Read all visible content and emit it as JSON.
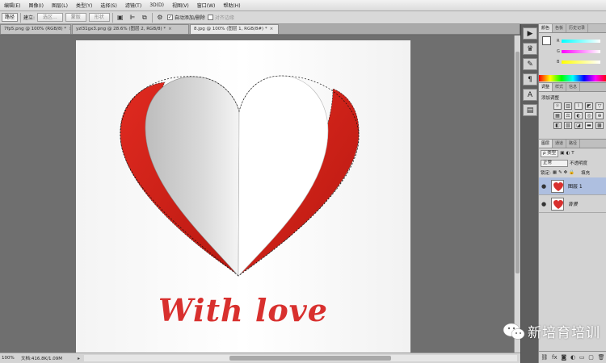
{
  "menu": [
    "编辑(E)",
    "图像(I)",
    "图层(L)",
    "类型(Y)",
    "选择(S)",
    "滤镜(T)",
    "3D(D)",
    "视图(V)",
    "窗口(W)",
    "帮助(H)"
  ],
  "options": {
    "preset": "路径",
    "make_label": "建立:",
    "selection_btn": "选区...",
    "mask_btn": "蒙版",
    "shape_btn": "形状",
    "auto_add_delete": "自动添加/删除",
    "align_edges": "对齐边缘"
  },
  "tabs": [
    {
      "label": "7fp5.png @ 100% (RGB/8) *",
      "active": false
    },
    {
      "label": "yzl31gx3.png @ 28.6% (图层 2, RGB/8) *",
      "active": false
    },
    {
      "label": "8.jpg @ 100% (图层 1, RGB/8#) *",
      "active": true
    }
  ],
  "tab_close": "×",
  "artwork": {
    "text": "With love",
    "accent_color": "#d8302e"
  },
  "status": {
    "zoom": "100%",
    "doc_size": "文档:416.8K/1.09M"
  },
  "color_panel": {
    "tabs": [
      "颜色",
      "色板",
      "历史记录"
    ],
    "labels": [
      "R",
      "G",
      "B"
    ],
    "values": [
      "255",
      "255",
      "255"
    ]
  },
  "adjust_panel": {
    "tabs": [
      "调整",
      "样式",
      "信息"
    ],
    "title": "添加调整"
  },
  "layers_panel": {
    "tabs": [
      "图层",
      "通道",
      "路径"
    ],
    "kind": "ρ 类型",
    "blend": "正常",
    "opacity_label": "不透明度",
    "lock_label": "锁定:",
    "fill_label": "填充",
    "layers": [
      {
        "name": "图层 1",
        "active": true
      },
      {
        "name": "背景",
        "active": false
      }
    ]
  },
  "watermark": {
    "text": "新培育培训"
  }
}
